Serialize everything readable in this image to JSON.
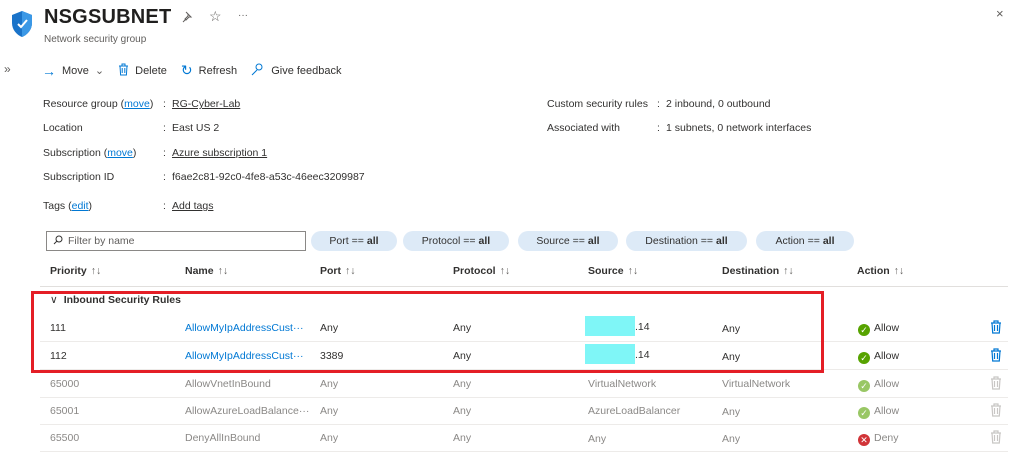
{
  "header": {
    "title": "NSGSUBNET",
    "subtitle": "Network security group",
    "pin_icon": "pin-icon",
    "star_icon": "star-icon",
    "more": "···",
    "close": "×"
  },
  "toolbar": {
    "move": "Move",
    "delete": "Delete",
    "refresh": "Refresh",
    "feedback": "Give feedback"
  },
  "essentials": {
    "resource_group_label": "Resource group",
    "move_link": "move",
    "resource_group_value": "RG-Cyber-Lab",
    "location_label": "Location",
    "location_value": "East US 2",
    "subscription_label": "Subscription",
    "subscription_value": "Azure subscription 1",
    "subscription_id_label": "Subscription ID",
    "subscription_id_value": "f6ae2c81-92c0-4fe8-a53c-46eec3209987",
    "tags_label": "Tags",
    "edit_link": "edit",
    "tags_value": "Add tags",
    "custom_rules_label": "Custom security rules",
    "custom_rules_value": "2 inbound, 0 outbound",
    "associated_label": "Associated with",
    "associated_value": "1 subnets, 0 network interfaces",
    "colon": ":"
  },
  "filters": {
    "placeholder": "Filter by name",
    "port": {
      "label": "Port ==",
      "value": "all"
    },
    "protocol": {
      "label": "Protocol ==",
      "value": "all"
    },
    "source": {
      "label": "Source ==",
      "value": "all"
    },
    "destination": {
      "label": "Destination ==",
      "value": "all"
    },
    "action": {
      "label": "Action ==",
      "value": "all"
    }
  },
  "table": {
    "columns": [
      "Priority",
      "Name",
      "Port",
      "Protocol",
      "Source",
      "Destination",
      "Action"
    ],
    "sort_glyph": "↑↓",
    "group_label": "Inbound Security Rules",
    "rows": [
      {
        "priority": "111",
        "name": "AllowMyIpAddressCust···",
        "port": "Any",
        "protocol": "Any",
        "source_suffix": ".14",
        "destination": "Any",
        "action": "Allow"
      },
      {
        "priority": "112",
        "name": "AllowMyIpAddressCust···",
        "port": "3389",
        "protocol": "Any",
        "source_suffix": ".14",
        "destination": "Any",
        "action": "Allow"
      },
      {
        "priority": "65000",
        "name": "AllowVnetInBound",
        "port": "Any",
        "protocol": "Any",
        "source": "VirtualNetwork",
        "destination": "VirtualNetwork",
        "action": "Allow"
      },
      {
        "priority": "65001",
        "name": "AllowAzureLoadBalance···",
        "port": "Any",
        "protocol": "Any",
        "source": "AzureLoadBalancer",
        "destination": "Any",
        "action": "Allow"
      },
      {
        "priority": "65500",
        "name": "DenyAllInBound",
        "port": "Any",
        "protocol": "Any",
        "source": "Any",
        "destination": "Any",
        "action": "Deny"
      }
    ]
  },
  "colors": {
    "accent": "#0078d4",
    "highlight_box": "#e41e26",
    "redaction": "#7ff6f7",
    "allow": "#57a300",
    "deny": "#d13438"
  }
}
